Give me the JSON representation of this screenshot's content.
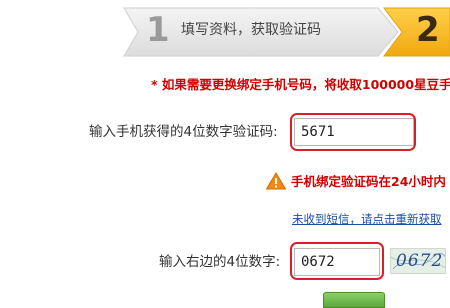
{
  "steps": {
    "step1": {
      "number": "1",
      "label": "填写资料，获取验证码"
    },
    "step2": {
      "number": "2"
    }
  },
  "notice": "* 如果需要更换绑定手机号码，将收取100000星豆手",
  "phone_code": {
    "label": "输入手机获得的4位数字验证码:",
    "value": "5671"
  },
  "warning": {
    "icon": "warning-icon",
    "text": "手机绑定验证码在24小时内"
  },
  "resend": {
    "prefix": "未收到短信，请点击重新获取"
  },
  "captcha_row": {
    "label": "输入右边的4位数字:",
    "value": "0672",
    "image_text": "0672"
  },
  "colors": {
    "accent_red": "#d00000",
    "highlight": "#d9202a",
    "step_active": "#f5b41c",
    "step_inactive": "#e6e6e6"
  }
}
